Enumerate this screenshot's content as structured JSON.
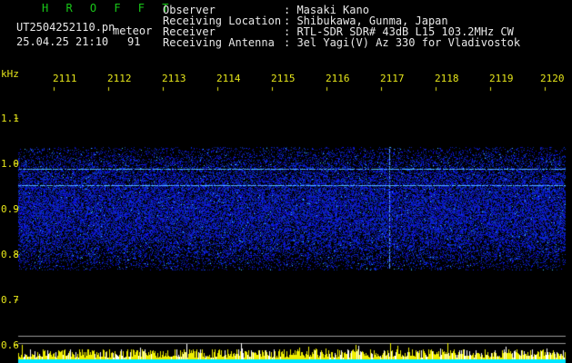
{
  "header": {
    "title": "H R O F F T",
    "filename": "UT2504252110.pn",
    "suffix": "meteor",
    "datetime": "25.04.25 21:10",
    "count": "91",
    "fields": [
      {
        "label": "Observer",
        "value": ": Masaki Kano"
      },
      {
        "label": "Receiving Location",
        "value": ": Shibukawa, Gunma, Japan"
      },
      {
        "label": "Receiver",
        "value": ": RTL-SDR SDR# 43dB L15 103.2MHz CW"
      },
      {
        "label": "Receiving Antenna",
        "value": ": 3el Yagi(V) Az 330 for Vladivostok"
      }
    ]
  },
  "axis": {
    "unit": "kHz",
    "y_labels": [
      "1.1",
      "1.0",
      "0.9",
      "0.8",
      "0.7",
      "0.6"
    ],
    "x_labels": [
      "2111",
      "2112",
      "2113",
      "2114",
      "2115",
      "2116",
      "2117",
      "2118",
      "2119",
      "2120"
    ]
  },
  "colors": {
    "signal": "#2a3cff",
    "text_yellow": "#e6e61a",
    "text_green": "#19c719",
    "bar_yellow": "#f0f000",
    "bar_cyan": "#00e6ff"
  }
}
